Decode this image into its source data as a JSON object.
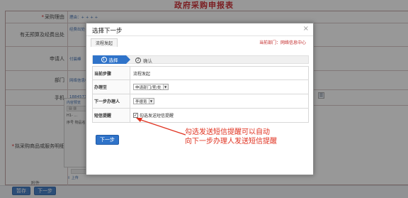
{
  "form": {
    "title": "政府采购申报表",
    "rows": [
      {
        "label": "采购理由",
        "required": true,
        "value": "理由：+ + + +"
      },
      {
        "label": "有无预算及经费出处",
        "required": false,
        "value": "经费出处~(..."
      },
      {
        "label": "申请人",
        "required": false,
        "value": "付晨峰"
      },
      {
        "label": "部门",
        "required": false,
        "value": "网络信息中..."
      },
      {
        "label": "手机",
        "required": false,
        "value": "1884573..."
      },
      {
        "label": "拟采购商品或服务明细",
        "required": true,
        "value": ""
      }
    ],
    "detail": {
      "preview_label": "内容预览",
      "heading": "H1-  ...",
      "columns": "序号  物品名..."
    },
    "attach_label": "上传",
    "bottom_label": "附件"
  },
  "bottom_buttons": {
    "pause": "暂存",
    "next": "下一步"
  },
  "dialog": {
    "title": "选择下一步",
    "close_glyph": "×",
    "tab": "流程发起",
    "dept_label": "当前部门：",
    "dept_value": "网络信息中心",
    "steps": [
      {
        "num": "1",
        "label": "选择"
      },
      {
        "num": "2",
        "label": "确认"
      }
    ],
    "fields": {
      "current_step_label": "当前步骤",
      "current_step_value": "流程发起",
      "handler_type_label": "办理至",
      "handler_type_value": "申请部门/室/处",
      "next_handler_label": "下一步办理人",
      "next_handler_value": "李德育",
      "sms_label": "短信提醒",
      "sms_option": "勾选发送短信提醒",
      "sms_checked": true
    },
    "next_button": "下一步"
  },
  "annotation": {
    "line1": "勾选发送短信提醒可以自动",
    "line2": "向下一步办理人发送短信提醒",
    "color": "#e0311f"
  },
  "colors": {
    "primary_blue": "#2f73c9",
    "title_red": "#c8161d"
  }
}
